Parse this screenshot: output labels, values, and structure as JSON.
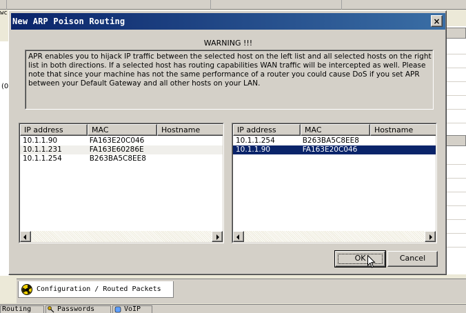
{
  "background": {
    "left_label": "wc",
    "left_paren": "(0",
    "config_tab_label": "Configuration / Routed Packets",
    "bottom_tabs": [
      {
        "label": "Routing"
      },
      {
        "label": "Passwords"
      },
      {
        "label": "VoIP"
      }
    ]
  },
  "dialog": {
    "title": "New ARP Poison Routing",
    "close_glyph": "×",
    "warning_title": "WARNING !!!",
    "warning_text": "APR enables you to hijack IP traffic between the selected host on the left list and all selected hosts on the right list in both directions. If a selected host has routing capabilities WAN traffic will be intercepted as well. Please note that since your machine has not the same performance of a router you could cause DoS if you set APR between your Default Gateway and all other hosts on your LAN.",
    "left_list": {
      "columns": [
        "IP address",
        "MAC",
        "Hostname"
      ],
      "rows": [
        {
          "ip": "10.1.1.90",
          "mac": "FA163E20C046",
          "hostname": "",
          "state": "normal"
        },
        {
          "ip": "10.1.1.231",
          "mac": "FA163E60286E",
          "hostname": "",
          "state": "alt"
        },
        {
          "ip": "10.1.1.254",
          "mac": "B263BA5C8EE8",
          "hostname": "",
          "state": "normal"
        }
      ]
    },
    "right_list": {
      "columns": [
        "IP address",
        "MAC",
        "Hostname"
      ],
      "rows": [
        {
          "ip": "10.1.1.254",
          "mac": "B263BA5C8EE8",
          "hostname": "",
          "state": "normal"
        },
        {
          "ip": "10.1.1.90",
          "mac": "FA163E20C046",
          "hostname": "",
          "state": "selected"
        }
      ]
    },
    "ok_label": "OK",
    "cancel_label": "Cancel"
  },
  "colors": {
    "title_bar_start": "#0a246a",
    "title_bar_end": "#3a6ea5",
    "selection": "#0a246a",
    "face": "#d4d0c8"
  }
}
